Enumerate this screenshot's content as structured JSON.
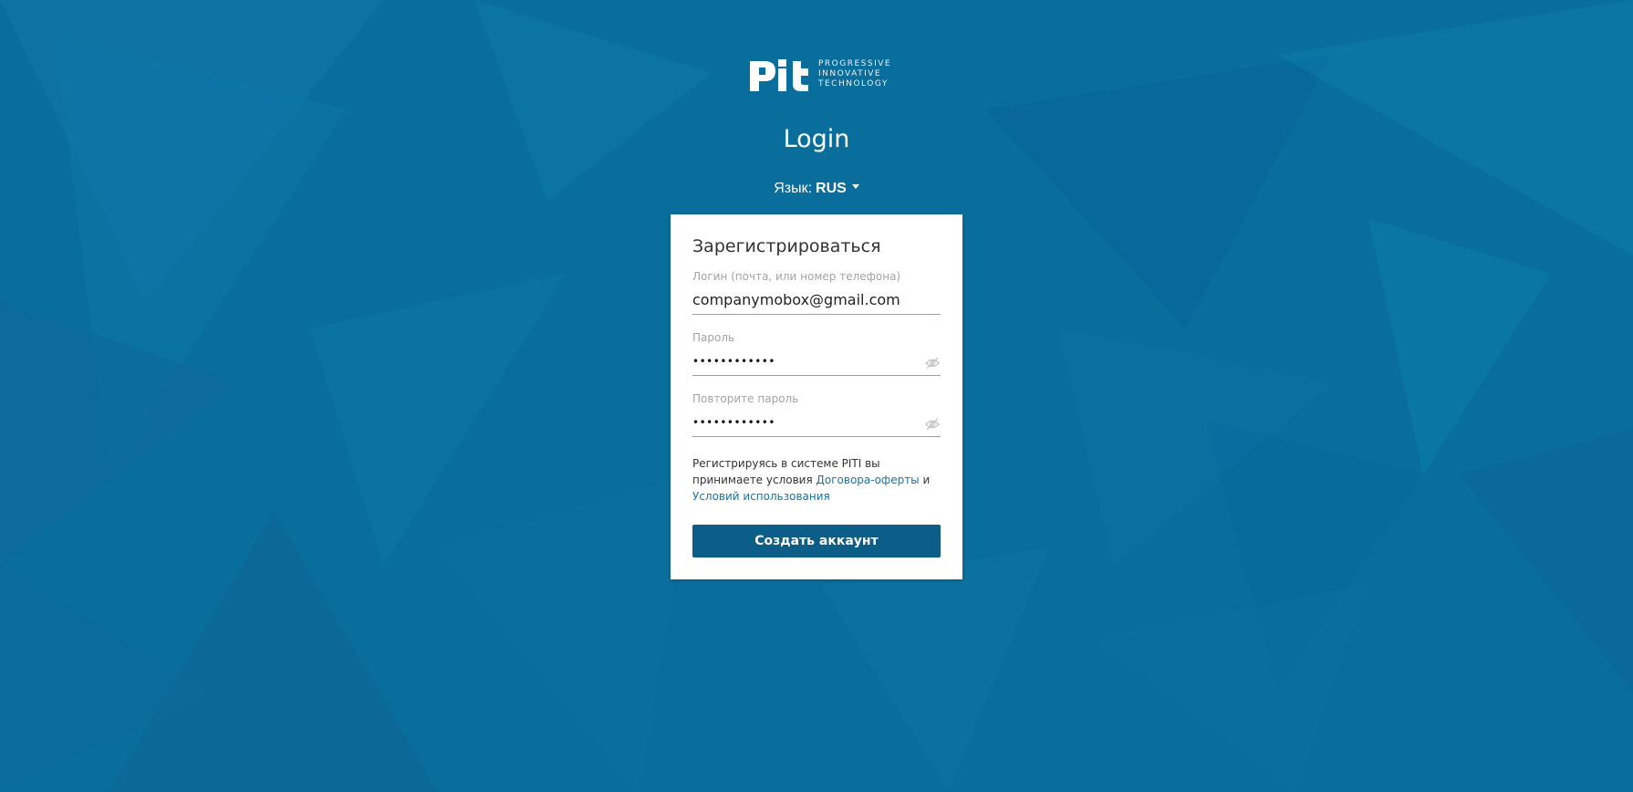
{
  "header": {
    "logo_text": "Pit",
    "logo_tagline": [
      "PROGRESSIVE",
      "INNOVATIVE",
      "TECHNOLOGY"
    ],
    "page_title": "Login"
  },
  "language": {
    "label": "Язык:",
    "value": "RUS",
    "icon": "caret-down-icon"
  },
  "form": {
    "title": "Зарегистрироваться",
    "login": {
      "label": "Логин (почта, или номер телефона)",
      "value": "companymobox@gmail.com"
    },
    "password": {
      "label": "Пароль",
      "masked_value": "••••••••••••",
      "icon": "eye-off-icon"
    },
    "repeat_password": {
      "label": "Повторите пароль",
      "masked_value": "••••••••••••",
      "icon": "eye-off-icon"
    },
    "terms": {
      "prefix": "Регистрируясь в системе PITI вы принимаете условия",
      "offer_link": "Договора-оферты",
      "conjunction": "и",
      "usage_link": "Условий использования"
    },
    "submit_label": "Создать аккаунт"
  },
  "colors": {
    "background": "#0a6e9c",
    "button": "#0c5d88",
    "link": "#1a73a8",
    "card": "#ffffff"
  }
}
